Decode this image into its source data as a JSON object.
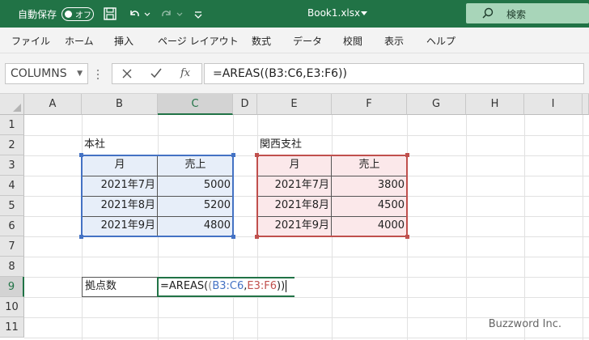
{
  "titlebar": {
    "autosave_label": "自動保存",
    "autosave_state": "オフ",
    "filename": "Book1.xlsx",
    "search_label": "検索"
  },
  "menu": [
    "ファイル",
    "ホーム",
    "挿入",
    "ページ レイアウト",
    "数式",
    "データ",
    "校閲",
    "表示",
    "ヘルプ"
  ],
  "formula_bar": {
    "name_box": "COLUMNS",
    "formula": "=AREAS((B3:C6,E3:F6))"
  },
  "columns": [
    "A",
    "B",
    "C",
    "D",
    "E",
    "F",
    "G",
    "H",
    "I"
  ],
  "rows": [
    "1",
    "2",
    "3",
    "4",
    "5",
    "6",
    "7",
    "8",
    "9",
    "10",
    "11"
  ],
  "sheet": {
    "honsha_title": "本社",
    "kansai_title": "関西支社",
    "header_month": "月",
    "header_sales": "売上",
    "honsha_rows": [
      {
        "month": "2021年7月",
        "sales": "5000"
      },
      {
        "month": "2021年8月",
        "sales": "5200"
      },
      {
        "month": "2021年9月",
        "sales": "4800"
      }
    ],
    "kansai_rows": [
      {
        "month": "2021年7月",
        "sales": "3800"
      },
      {
        "month": "2021年8月",
        "sales": "4500"
      },
      {
        "month": "2021年9月",
        "sales": "4000"
      }
    ],
    "label_b9": "拠点数",
    "edit_prefix": "=AREAS(",
    "edit_open_paren": "(",
    "edit_ref1": "B3:C6",
    "edit_comma": ",",
    "edit_ref2": "E3:F6",
    "edit_close_parens": "))"
  },
  "watermark": "Buzzword Inc.",
  "colors": {
    "excel_green": "#217346",
    "ref_blue": "#4472c4",
    "ref_red": "#c0504d"
  }
}
